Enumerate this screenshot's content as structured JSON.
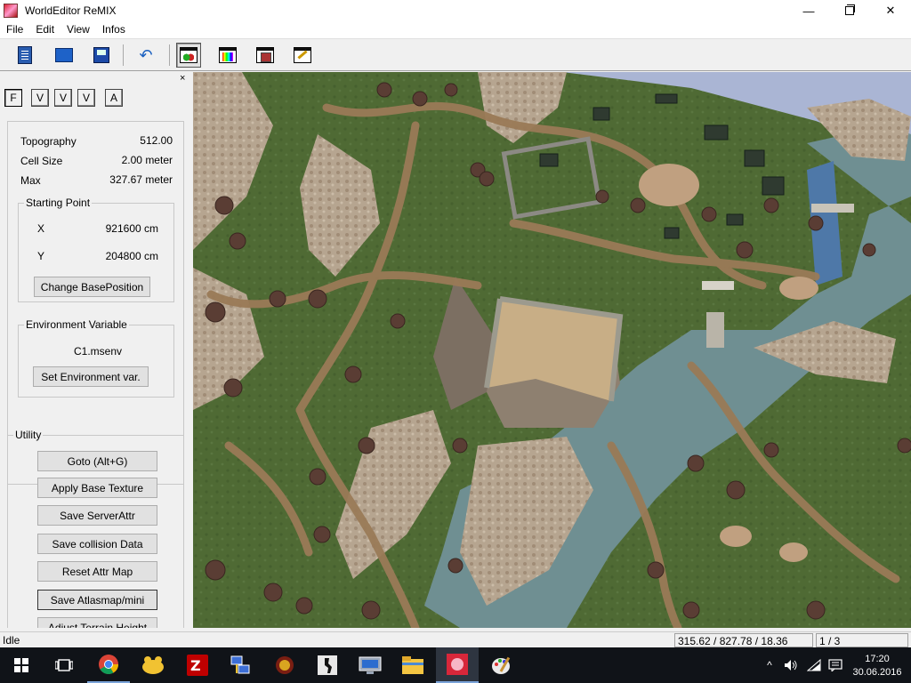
{
  "window": {
    "title": "WorldEditor ReMIX",
    "min_glyph": "—",
    "close_glyph": "✕"
  },
  "menu": [
    "File",
    "Edit",
    "View",
    "Infos"
  ],
  "toolbar": {
    "buttons": [
      "new-document-icon",
      "open-folder-icon",
      "save-disk-icon",
      "undo-icon",
      "terrain-view-icon",
      "palette-view-icon",
      "texture-view-icon",
      "brush-view-icon"
    ]
  },
  "side_panel": {
    "close_glyph": "×",
    "mode_buttons": [
      "F",
      "V",
      "V",
      "V",
      "A"
    ],
    "topography_label": "Topography",
    "topography_value": "512.00",
    "cell_size_label": "Cell Size",
    "cell_size_value": "2.00 meter",
    "max_label": "Max",
    "max_value": "327.67 meter",
    "starting_point": {
      "title": "Starting Point",
      "x_label": "X",
      "x_value": "921600 cm",
      "y_label": "Y",
      "y_value": "204800 cm",
      "button": "Change BasePosition"
    },
    "environment": {
      "title": "Environment Variable",
      "value": "C1.msenv",
      "button": "Set Environment var."
    },
    "utility": {
      "title": "Utility",
      "buttons": [
        "Goto (Alt+G)",
        "Apply Base Texture",
        "Save ServerAttr",
        "Save collision Data",
        "Reset Attr Map",
        "Save Atlasmap/mini",
        "Adjust Terrain Height"
      ]
    }
  },
  "status": {
    "state": "Idle",
    "coordinates": "315.62 / 827.78 / 18.36",
    "page": "1 / 3"
  },
  "taskbar": {
    "apps": [
      "task-view-icon",
      "chrome-icon",
      "app-yellow-icon",
      "filezilla-icon",
      "network-icon",
      "game-icon",
      "counter-strike-icon",
      "remote-desktop-icon",
      "file-explorer-icon",
      "worldeditor-icon",
      "paint-icon"
    ],
    "time": "17:20",
    "date": "30.06.2016"
  },
  "colors": {
    "grass": "#4f6a34",
    "dirt_path": "#9a7a57",
    "rock": "#b6a590",
    "water": "#6f8f92",
    "taskbar": "#101318"
  }
}
